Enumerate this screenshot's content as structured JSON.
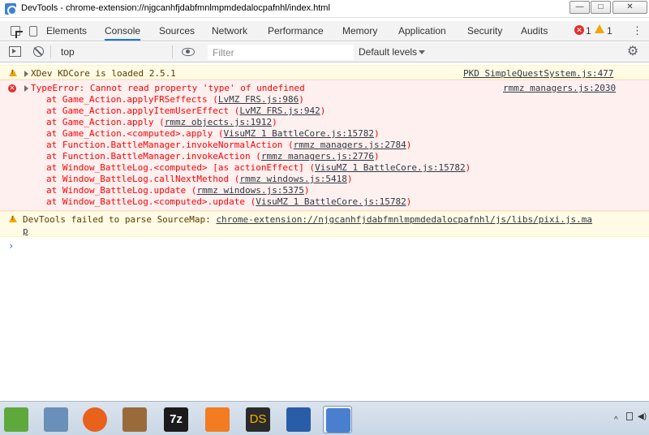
{
  "window": {
    "title": "DevTools - chrome-extension://njgcanhfjdabfmnlmpmdedalocpafnhl/index.html",
    "minimize_glyph": "—",
    "maximize_glyph": "□",
    "close_glyph": "✕"
  },
  "tabs": [
    {
      "label": "Elements",
      "active": false
    },
    {
      "label": "Console",
      "active": true
    },
    {
      "label": "Sources",
      "active": false
    },
    {
      "label": "Network",
      "active": false
    },
    {
      "label": "Performance",
      "active": false
    },
    {
      "label": "Memory",
      "active": false
    },
    {
      "label": "Application",
      "active": false
    },
    {
      "label": "Security",
      "active": false
    },
    {
      "label": "Audits",
      "active": false
    }
  ],
  "badges": {
    "errors": "1",
    "warnings": "1"
  },
  "console_toolbar": {
    "context": "top",
    "filter_placeholder": "Filter",
    "levels": "Default levels"
  },
  "messages": {
    "warn1": {
      "text": "XDev KDCore is loaded 2.5.1",
      "source": "PKD SimpleQuestSystem.js:477"
    },
    "error1": {
      "text": "TypeError: Cannot read property 'type' of undefined",
      "source": "rmmz managers.js:2030",
      "stack": [
        {
          "fn": "at Game_Action.applyFRSeffects (",
          "link": "LvMZ FRS.js:986",
          "end": ")"
        },
        {
          "fn": "at Game_Action.applyItemUserEffect (",
          "link": "LvMZ FRS.js:942",
          "end": ")"
        },
        {
          "fn": "at Game_Action.apply (",
          "link": "rmmz objects.js:1912",
          "end": ")"
        },
        {
          "fn": "at Game_Action.<computed>.apply (",
          "link": "VisuMZ 1 BattleCore.js:15782",
          "end": ")"
        },
        {
          "fn": "at Function.BattleManager.invokeNormalAction (",
          "link": "rmmz managers.js:2784",
          "end": ")"
        },
        {
          "fn": "at Function.BattleManager.invokeAction (",
          "link": "rmmz managers.js:2776",
          "end": ")"
        },
        {
          "fn": "at Window_BattleLog.<computed> [as actionEffect] (",
          "link": "VisuMZ 1 BattleCore.js:15782",
          "end": ")"
        },
        {
          "fn": "at Window_BattleLog.callNextMethod (",
          "link": "rmmz windows.js:5418",
          "end": ")"
        },
        {
          "fn": "at Window_BattleLog.update (",
          "link": "rmmz windows.js:5375",
          "end": ")"
        },
        {
          "fn": "at Window_BattleLog.<computed>.update (",
          "link": "VisuMZ 1 BattleCore.js:15782",
          "end": ")"
        }
      ]
    },
    "warn2": {
      "text": "DevTools failed to parse SourceMap: ",
      "link": "chrome-extension://njgcanhfjdabfmnlmpmdedalocpafnhl/js/libs/pixi.js.ma",
      "link_wrap": "p"
    }
  },
  "prompt_glyph": "›",
  "taskbar": {
    "icons": [
      "notepad-plus-icon",
      "castle-app-icon",
      "firefox-icon",
      "game-app-icon",
      "7zip-icon",
      "xampp-icon",
      "ds-icon",
      "devtools-icon",
      "devtools-active-icon"
    ],
    "icon_colors": [
      "#5fa83b",
      "#6a8fb8",
      "#e8621c",
      "#9a6b3a",
      "#1b1b1b",
      "#f37c20",
      "#2a2a2a",
      "#2a5da8",
      "#4a7fd0"
    ],
    "ds_label": "DS",
    "zip_label": "7z",
    "tray_up": "^",
    "tray_vol": "◀)"
  }
}
